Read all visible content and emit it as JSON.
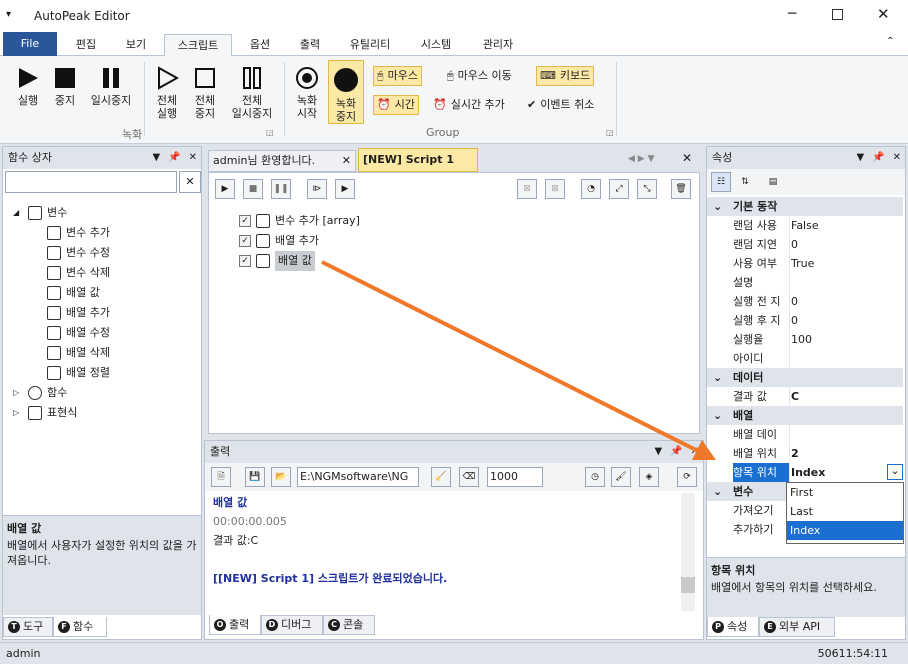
{
  "window": {
    "title": "AutoPeak Editor"
  },
  "menu": {
    "file": "File",
    "tabs": [
      "편집",
      "보기",
      "스크립트",
      "옵션",
      "출력",
      "유틸리티",
      "시스템",
      "관리자"
    ],
    "active": "스크립트"
  },
  "ribbon": {
    "run": "실행",
    "stop": "중지",
    "pause": "일시중지",
    "run_all": [
      "전체",
      "실행"
    ],
    "stop_all": [
      "전체",
      "중지"
    ],
    "pause_all": [
      "전체",
      "일시중지"
    ],
    "group_record": "녹화",
    "rec_start": [
      "녹화",
      "시작"
    ],
    "rec_stop": [
      "녹화",
      "중지"
    ],
    "mouse": "마우스",
    "mouse_move": "마우스 이동",
    "keyboard": "키보드",
    "time": "시간",
    "realtime_add": "실시간 추가",
    "event_cancel": "이벤트 취소",
    "group_group": "Group"
  },
  "func_panel": {
    "title": "함수 상자",
    "search_value": "",
    "items": [
      {
        "label": "변수",
        "level": 0,
        "expand": "◢"
      },
      {
        "label": "변수 추가",
        "level": 1
      },
      {
        "label": "변수 수정",
        "level": 1
      },
      {
        "label": "변수 삭제",
        "level": 1
      },
      {
        "label": "배열 값",
        "level": 1
      },
      {
        "label": "배열 추가",
        "level": 1
      },
      {
        "label": "배열 수정",
        "level": 1
      },
      {
        "label": "배열 삭제",
        "level": 1
      },
      {
        "label": "배열 정렬",
        "level": 1
      },
      {
        "label": "함수",
        "level": 0,
        "expand": "▷"
      },
      {
        "label": "표현식",
        "level": 0,
        "expand": "▷"
      }
    ],
    "desc_title": "배열 값",
    "desc_text": "배열에서 사용자가 설정한 위치의 값을 가져옵니다.",
    "tabs": [
      {
        "key": "T",
        "label": "도구"
      },
      {
        "key": "F",
        "label": "함수"
      }
    ]
  },
  "editor": {
    "tabs": [
      "admin님 환영합니다.",
      "[NEW] Script 1"
    ],
    "active_tab": "[NEW] Script 1",
    "lines": [
      {
        "label": "변수 추가 [array]",
        "checked": "✓"
      },
      {
        "label": "배열 추가",
        "checked": "✓"
      },
      {
        "label": "배열 값",
        "checked": "✓"
      }
    ]
  },
  "output": {
    "title": "출력",
    "path": "E:\\NGMsoftware\\NG",
    "count": "1000",
    "lines": [
      {
        "text": "배열 값",
        "color": "#1f2f9e",
        "bold": true
      },
      {
        "text": "00:00:00.005",
        "color": "#777777",
        "bold": false
      },
      {
        "text": "결과 값:C",
        "color": "#1e1e1e",
        "bold": false
      },
      {
        "text": "",
        "color": "#1e1e1e",
        "bold": false
      },
      {
        "text": "[[NEW] Script 1] 스크립트가 완료되었습니다.",
        "color": "#1f2f9e",
        "bold": true
      }
    ],
    "tabs": [
      {
        "key": "O",
        "label": "출력"
      },
      {
        "key": "D",
        "label": "디버그"
      },
      {
        "key": "C",
        "label": "콘솔"
      }
    ]
  },
  "props": {
    "title": "속성",
    "categories": [
      {
        "name": "기본 동작",
        "rows": [
          {
            "k": "랜덤 사용",
            "v": "False"
          },
          {
            "k": "랜덤 지연",
            "v": "0"
          },
          {
            "k": "사용 여부",
            "v": "True"
          },
          {
            "k": "설명",
            "v": ""
          },
          {
            "k": "실행 전 지",
            "v": "0"
          },
          {
            "k": "실행 후 지",
            "v": "0"
          },
          {
            "k": "실행율",
            "v": "100"
          },
          {
            "k": "아이디",
            "v": ""
          }
        ]
      },
      {
        "name": "데이터",
        "rows": [
          {
            "k": "결과 값",
            "v": "C"
          }
        ]
      },
      {
        "name": "배열",
        "rows": [
          {
            "k": "배열 데이",
            "v": ""
          },
          {
            "k": "배열 위치",
            "v": "2"
          },
          {
            "k": "항목 위치",
            "v": "Index"
          }
        ]
      },
      {
        "name": "변수",
        "rows": [
          {
            "k": "가져오기",
            "v": ""
          },
          {
            "k": "추가하기",
            "v": ""
          }
        ]
      }
    ],
    "dropdown_options": [
      "First",
      "Last",
      "Index"
    ],
    "dropdown_selected": "Index",
    "desc_title": "항목 위치",
    "desc_text": "배열에서 항목의 위치를 선택하세요.",
    "tabs": [
      {
        "key": "P",
        "label": "속성"
      },
      {
        "key": "E",
        "label": "외부 API"
      }
    ]
  },
  "status": {
    "user": "admin",
    "time": "50611:54:11"
  },
  "colors": {
    "accent": "#2b579a",
    "highlight": "#fde9a6",
    "arrow": "#f0782a",
    "select": "#1b6fd1"
  }
}
